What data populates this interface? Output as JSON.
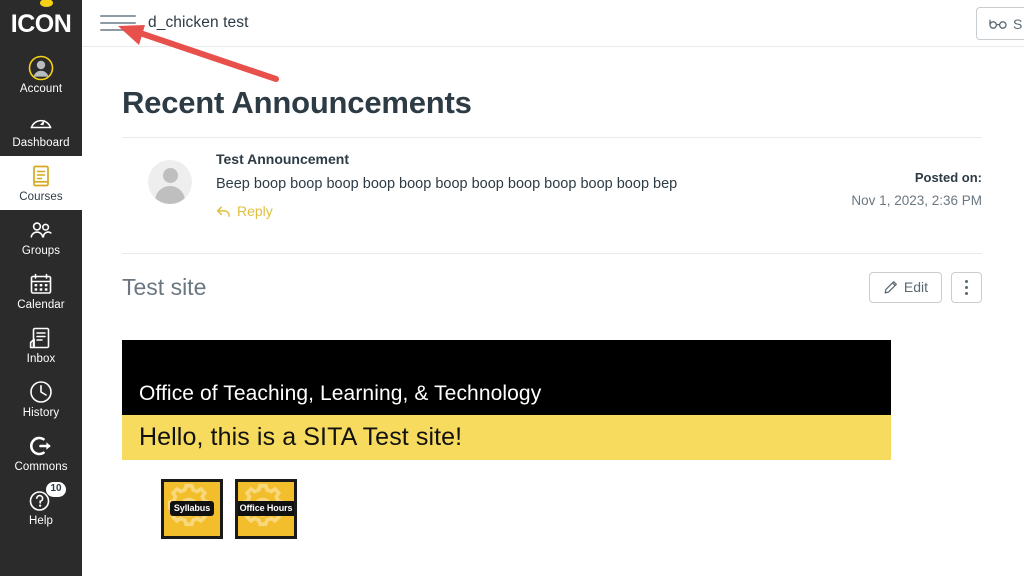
{
  "brand": {
    "logo_text": "ICON",
    "logo_accent_color": "#F7D117"
  },
  "global_nav": {
    "items": [
      {
        "label": "Account",
        "icon": "user-avatar-icon",
        "active": false,
        "badge": null
      },
      {
        "label": "Dashboard",
        "icon": "dashboard-gauge-icon",
        "active": false,
        "badge": null
      },
      {
        "label": "Courses",
        "icon": "courses-book-icon",
        "active": true,
        "badge": null
      },
      {
        "label": "Groups",
        "icon": "groups-people-icon",
        "active": false,
        "badge": null
      },
      {
        "label": "Calendar",
        "icon": "calendar-icon",
        "active": false,
        "badge": null
      },
      {
        "label": "Inbox",
        "icon": "inbox-tray-icon",
        "active": false,
        "badge": null
      },
      {
        "label": "History",
        "icon": "history-clock-icon",
        "active": false,
        "badge": null
      },
      {
        "label": "Commons",
        "icon": "commons-arrow-icon",
        "active": false,
        "badge": null
      },
      {
        "label": "Help",
        "icon": "help-question-icon",
        "active": false,
        "badge": "10"
      }
    ]
  },
  "header": {
    "menu_icon": "hamburger-menu-icon",
    "breadcrumb": "d_chicken test",
    "student_view_label": "S",
    "student_view_icon": "eyeglasses-icon"
  },
  "main": {
    "page_title": "Recent Announcements",
    "announcement": {
      "avatar_icon": "user-avatar-placeholder",
      "title": "Test Announcement",
      "body": "Beep boop boop boop boop boop boop boop boop boop boop boop bep",
      "reply_label": "Reply",
      "reply_icon": "reply-arrow-icon",
      "reply_color": "#E0C03F",
      "posted_on_label": "Posted on:",
      "posted_on_value": "Nov 1, 2023, 2:36 PM"
    },
    "section": {
      "title": "Test site",
      "edit_label": "Edit",
      "edit_icon": "pencil-icon",
      "kebab_icon": "more-vertical-icon"
    },
    "banner": {
      "top_text": "Office of Teaching, Learning, & Technology",
      "top_bg": "#000000",
      "top_fg": "#ffffff",
      "bottom_text": "Hello, this is a SITA Test site!",
      "bottom_bg": "#F7DB5E",
      "bottom_fg": "#111111"
    },
    "tiles": [
      {
        "label": "Syllabus",
        "icon": "gear-tile-icon",
        "bg": "#F2BE2C"
      },
      {
        "label": "Office Hours",
        "icon": "gear-tile-icon",
        "bg": "#F2BE2C"
      }
    ]
  },
  "annotation": {
    "arrow_color": "#E8514B",
    "target_icon": "hamburger-menu-icon"
  }
}
